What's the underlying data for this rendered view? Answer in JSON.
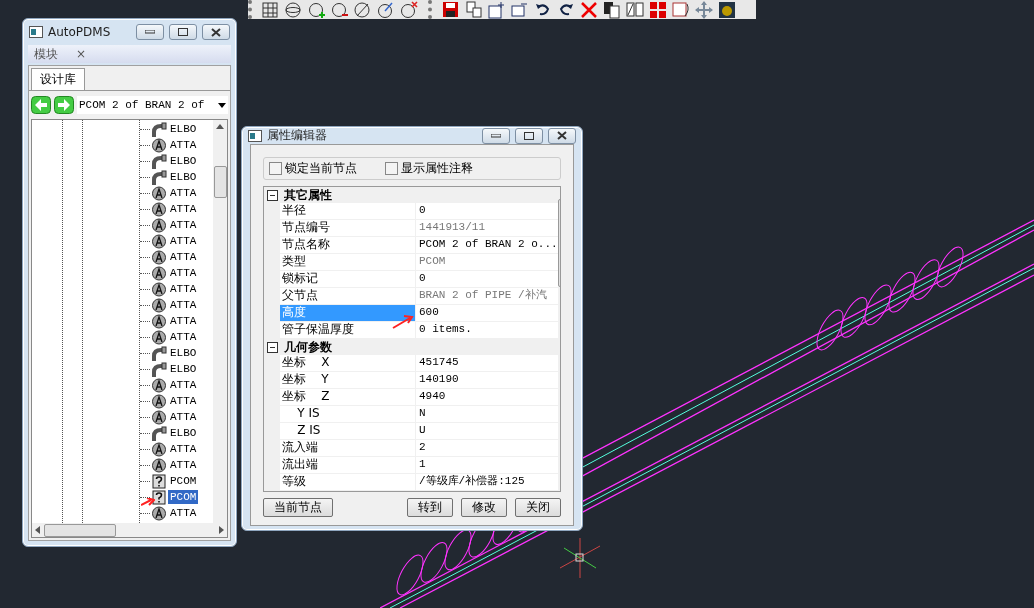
{
  "tree_window": {
    "title": "AutoPDMS",
    "panel_tab": "模块",
    "panel_close": "×",
    "tabs": [
      {
        "label": "设计库",
        "selected": true
      }
    ],
    "path": "PCOM 2 of BRAN 2 of",
    "items": [
      {
        "kind": "elbo",
        "label": "ELBO",
        "selected": false
      },
      {
        "kind": "atta",
        "label": "ATTA",
        "selected": false
      },
      {
        "kind": "elbo",
        "label": "ELBO",
        "selected": false
      },
      {
        "kind": "elbo",
        "label": "ELBO",
        "selected": false
      },
      {
        "kind": "atta",
        "label": "ATTA",
        "selected": false
      },
      {
        "kind": "atta",
        "label": "ATTA",
        "selected": false
      },
      {
        "kind": "atta",
        "label": "ATTA",
        "selected": false
      },
      {
        "kind": "atta",
        "label": "ATTA",
        "selected": false
      },
      {
        "kind": "atta",
        "label": "ATTA",
        "selected": false
      },
      {
        "kind": "atta",
        "label": "ATTA",
        "selected": false
      },
      {
        "kind": "atta",
        "label": "ATTA",
        "selected": false
      },
      {
        "kind": "atta",
        "label": "ATTA",
        "selected": false
      },
      {
        "kind": "atta",
        "label": "ATTA",
        "selected": false
      },
      {
        "kind": "atta",
        "label": "ATTA",
        "selected": false
      },
      {
        "kind": "elbo",
        "label": "ELBO",
        "selected": false
      },
      {
        "kind": "elbo",
        "label": "ELBO",
        "selected": false
      },
      {
        "kind": "atta",
        "label": "ATTA",
        "selected": false
      },
      {
        "kind": "atta",
        "label": "ATTA",
        "selected": false
      },
      {
        "kind": "atta",
        "label": "ATTA",
        "selected": false
      },
      {
        "kind": "elbo",
        "label": "ELBO",
        "selected": false
      },
      {
        "kind": "atta",
        "label": "ATTA",
        "selected": false
      },
      {
        "kind": "atta",
        "label": "ATTA",
        "selected": false
      },
      {
        "kind": "pcom",
        "label": "PCOM",
        "selected": false
      },
      {
        "kind": "pcom",
        "label": "PCOM",
        "selected": true
      },
      {
        "kind": "atta",
        "label": "ATTA",
        "selected": false
      }
    ]
  },
  "editor": {
    "title": "属性编辑器",
    "options": [
      {
        "label": "锁定当前节点",
        "checked": false
      },
      {
        "label": "显示属性注释",
        "checked": false
      }
    ],
    "groups": [
      {
        "title": "其它属性",
        "expanded": true,
        "rows": [
          {
            "name": "半径",
            "value": "0",
            "readonly": false,
            "selected": false
          },
          {
            "name": "节点编号",
            "value": "1441913/11",
            "readonly": true,
            "selected": false
          },
          {
            "name": "节点名称",
            "value": "PCOM 2 of BRAN 2 o...",
            "readonly": false,
            "selected": false
          },
          {
            "name": "类型",
            "value": "PCOM",
            "readonly": true,
            "selected": false
          },
          {
            "name": "锁标记",
            "value": "0",
            "readonly": false,
            "selected": false
          },
          {
            "name": "父节点",
            "value": "BRAN 2 of PIPE /补汽",
            "readonly": true,
            "selected": false
          },
          {
            "name": "高度",
            "value": "600",
            "readonly": false,
            "selected": true
          },
          {
            "name": "管子保温厚度",
            "value": "0 items.",
            "readonly": false,
            "selected": false
          }
        ]
      },
      {
        "title": "几何参数",
        "expanded": true,
        "rows": [
          {
            "name": "坐标    X",
            "value": "451745",
            "readonly": false,
            "selected": false
          },
          {
            "name": "坐标    Y",
            "value": "140190",
            "readonly": false,
            "selected": false
          },
          {
            "name": "坐标    Z",
            "value": "4940",
            "readonly": false,
            "selected": false
          },
          {
            "name": "    Y IS",
            "value": "N",
            "readonly": false,
            "selected": false
          },
          {
            "name": "    Z IS",
            "value": "U",
            "readonly": false,
            "selected": false
          },
          {
            "name": "流入端",
            "value": "2",
            "readonly": false,
            "selected": false
          },
          {
            "name": "流出端",
            "value": "1",
            "readonly": false,
            "selected": false
          },
          {
            "name": "等级",
            "value": "/等级库/补偿器:125",
            "readonly": false,
            "selected": false
          }
        ]
      }
    ],
    "buttons": [
      "当前节点",
      "转到",
      "修改",
      "关闭"
    ]
  }
}
